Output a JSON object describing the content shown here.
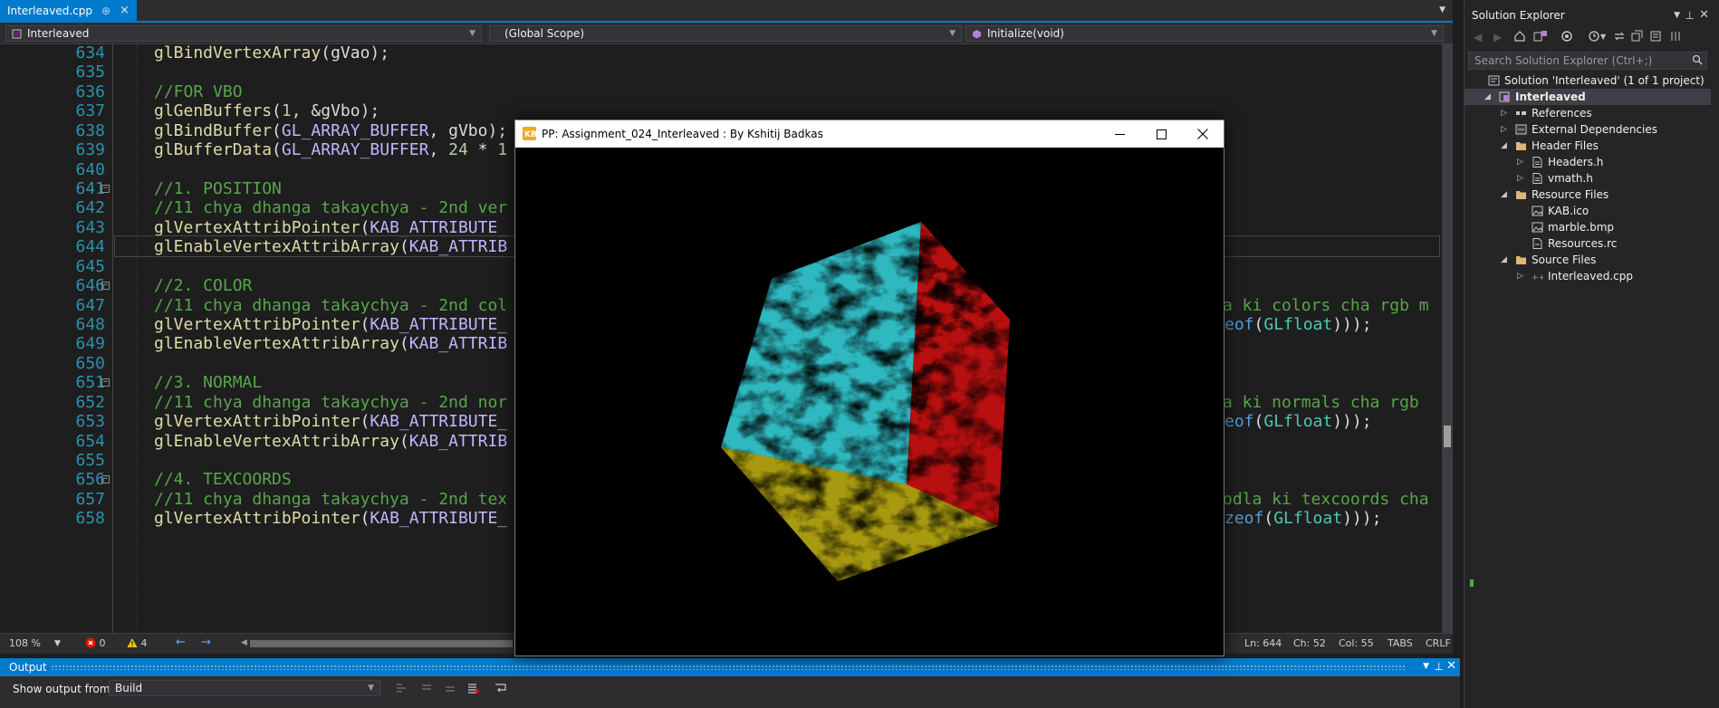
{
  "editor": {
    "tab_label": "Interleaved.cpp",
    "tab_pin": "⊕",
    "tab_close": "×",
    "nav": {
      "project": "Interleaved",
      "scope": "(Global Scope)",
      "member": "Initialize(void)"
    },
    "lines": [
      {
        "num": "634",
        "text": "glBindVertexArray(gVao);"
      },
      {
        "num": "635",
        "text": ""
      },
      {
        "num": "636",
        "text": "//FOR VBO"
      },
      {
        "num": "637",
        "text": "glGenBuffers(1, &gVbo);"
      },
      {
        "num": "638",
        "text": "glBindBuffer(GL_ARRAY_BUFFER, gVbo);"
      },
      {
        "num": "639",
        "text": "glBufferData(GL_ARRAY_BUFFER, 24 * 1"
      },
      {
        "num": "640",
        "text": ""
      },
      {
        "num": "641",
        "text": "//1. POSITION"
      },
      {
        "num": "642",
        "text": "//11 chya dhanga takaychya - 2nd ver"
      },
      {
        "num": "643",
        "text": "glVertexAttribPointer(KAB_ATTRIBUTE_"
      },
      {
        "num": "644",
        "text": "glEnableVertexAttribArray(KAB_ATTRIB"
      },
      {
        "num": "645",
        "text": ""
      },
      {
        "num": "646",
        "text": "//2. COLOR"
      },
      {
        "num": "647",
        "text": "//11 chya dhanga takaychya - 2nd col"
      },
      {
        "num": "648",
        "text": "glVertexAttribPointer(KAB_ATTRIBUTE_"
      },
      {
        "num": "649",
        "text": "glEnableVertexAttribArray(KAB_ATTRIB"
      },
      {
        "num": "650",
        "text": ""
      },
      {
        "num": "651",
        "text": "//3. NORMAL"
      },
      {
        "num": "652",
        "text": "//11 chya dhanga takaychya - 2nd nor"
      },
      {
        "num": "653",
        "text": "glVertexAttribPointer(KAB_ATTRIBUTE_"
      },
      {
        "num": "654",
        "text": "glEnableVertexAttribArray(KAB_ATTRIB"
      },
      {
        "num": "655",
        "text": ""
      },
      {
        "num": "656",
        "text": "//4. TEXCOORDS"
      },
      {
        "num": "657",
        "text": "//11 chya dhanga takaychya - 2nd tex"
      },
      {
        "num": "658",
        "text": "glVertexAttribPointer(KAB_ATTRIBUTE_"
      }
    ],
    "right_fragments": {
      "r647": "a ki colors cha rgb m",
      "r648": "eof(GLfloat)));",
      "r652": "a ki normals cha rgb",
      "r653": "eof(GLfloat)));",
      "r657": "odla ki texcoords cha",
      "r658": "zeof(GLfloat)));"
    },
    "status": {
      "zoom": "108 %",
      "errors": "0",
      "warnings": "4",
      "ln": "Ln: 644",
      "ch": "Ch: 52",
      "col": "Col: 55",
      "tabs": "TABS",
      "eol": "CRLF"
    }
  },
  "output": {
    "title": "Output",
    "show_from_label": "Show output from:",
    "source": "Build"
  },
  "solution_explorer": {
    "title": "Solution Explorer",
    "search_placeholder": "Search Solution Explorer (Ctrl+;)",
    "tree": [
      {
        "label": "Solution 'Interleaved' (1 of 1 project)",
        "icon": "solution-icon"
      },
      {
        "label": "Interleaved",
        "icon": "project-icon"
      },
      {
        "label": "References",
        "icon": "references-icon"
      },
      {
        "label": "External Dependencies",
        "icon": "dependencies-icon"
      },
      {
        "label": "Header Files",
        "icon": "folder-icon"
      },
      {
        "label": "Headers.h",
        "icon": "header-file-icon"
      },
      {
        "label": "vmath.h",
        "icon": "header-file-icon"
      },
      {
        "label": "Resource Files",
        "icon": "folder-icon"
      },
      {
        "label": "KAB.ico",
        "icon": "image-file-icon"
      },
      {
        "label": "marble.bmp",
        "icon": "image-file-icon"
      },
      {
        "label": "Resources.rc",
        "icon": "resource-file-icon"
      },
      {
        "label": "Source Files",
        "icon": "folder-icon"
      },
      {
        "label": "Interleaved.cpp",
        "icon": "cpp-file-icon"
      }
    ]
  },
  "gl_window": {
    "title": "PP: Assignment_024_Interleaved : By Kshitij Badkas",
    "cube_faces": {
      "top": "#2fb8c0",
      "right": "#b81010",
      "bottom": "#a89a10"
    }
  }
}
